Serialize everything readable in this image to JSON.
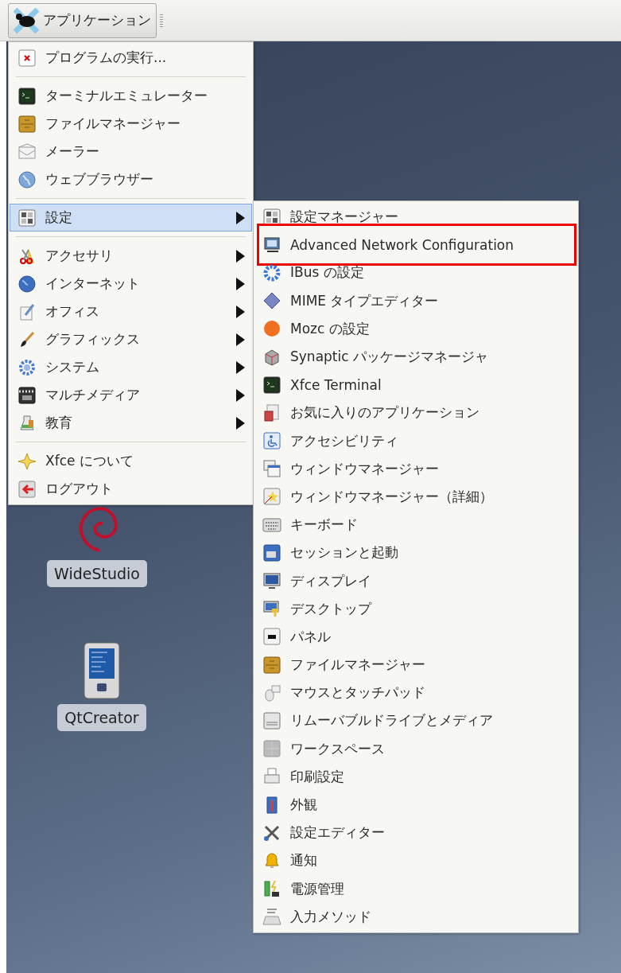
{
  "panel": {
    "applications_button": "アプリケーション"
  },
  "main_menu": {
    "items": [
      {
        "kind": "item",
        "label": "プログラムの実行...",
        "selected": false
      },
      {
        "kind": "separator"
      },
      {
        "kind": "item",
        "label": "ターミナルエミュレーター",
        "selected": false
      },
      {
        "kind": "item",
        "label": "ファイルマネージャー",
        "selected": false
      },
      {
        "kind": "item",
        "label": "メーラー",
        "selected": false
      },
      {
        "kind": "item",
        "label": "ウェブブラウザー",
        "selected": false
      },
      {
        "kind": "separator"
      },
      {
        "kind": "submenu",
        "label": "設定",
        "selected": true
      },
      {
        "kind": "separator"
      },
      {
        "kind": "submenu",
        "label": "アクセサリ",
        "selected": false
      },
      {
        "kind": "submenu",
        "label": "インターネット",
        "selected": false
      },
      {
        "kind": "submenu",
        "label": "オフィス",
        "selected": false
      },
      {
        "kind": "submenu",
        "label": "グラフィックス",
        "selected": false
      },
      {
        "kind": "submenu",
        "label": "システム",
        "selected": false
      },
      {
        "kind": "submenu",
        "label": "マルチメディア",
        "selected": false
      },
      {
        "kind": "submenu",
        "label": "教育",
        "selected": false
      },
      {
        "kind": "separator"
      },
      {
        "kind": "item",
        "label": "Xfce について",
        "selected": false
      },
      {
        "kind": "item",
        "label": "ログアウト",
        "selected": false
      }
    ]
  },
  "settings_submenu": {
    "items": [
      {
        "label": "設定マネージャー",
        "highlighted": false
      },
      {
        "label": "Advanced Network Configuration",
        "highlighted": true
      },
      {
        "label": "IBus の設定",
        "highlighted": false
      },
      {
        "label": "MIME タイプエディター",
        "highlighted": false
      },
      {
        "label": "Mozc の設定",
        "highlighted": false
      },
      {
        "label": "Synaptic パッケージマネージャ",
        "highlighted": false
      },
      {
        "label": "Xfce Terminal",
        "highlighted": false
      },
      {
        "label": "お気に入りのアプリケーション",
        "highlighted": false
      },
      {
        "label": "アクセシビリティ",
        "highlighted": false
      },
      {
        "label": "ウィンドウマネージャー",
        "highlighted": false
      },
      {
        "label": "ウィンドウマネージャー（詳細）",
        "highlighted": false
      },
      {
        "label": "キーボード",
        "highlighted": false
      },
      {
        "label": "セッションと起動",
        "highlighted": false
      },
      {
        "label": "ディスプレイ",
        "highlighted": false
      },
      {
        "label": "デスクトップ",
        "highlighted": false
      },
      {
        "label": "パネル",
        "highlighted": false
      },
      {
        "label": "ファイルマネージャー",
        "highlighted": false
      },
      {
        "label": "マウスとタッチパッド",
        "highlighted": false
      },
      {
        "label": "リムーバブルドライブとメディア",
        "highlighted": false
      },
      {
        "label": "ワークスペース",
        "highlighted": false
      },
      {
        "label": "印刷設定",
        "highlighted": false
      },
      {
        "label": "外観",
        "highlighted": false
      },
      {
        "label": "設定エディター",
        "highlighted": false
      },
      {
        "label": "通知",
        "highlighted": false
      },
      {
        "label": "電源管理",
        "highlighted": false
      },
      {
        "label": "入力メソッド",
        "highlighted": false
      }
    ]
  },
  "desktop_icons": [
    {
      "kind": "swirl",
      "label": "WideStudio"
    },
    {
      "kind": "handheld",
      "label": "QtCreator"
    }
  ]
}
